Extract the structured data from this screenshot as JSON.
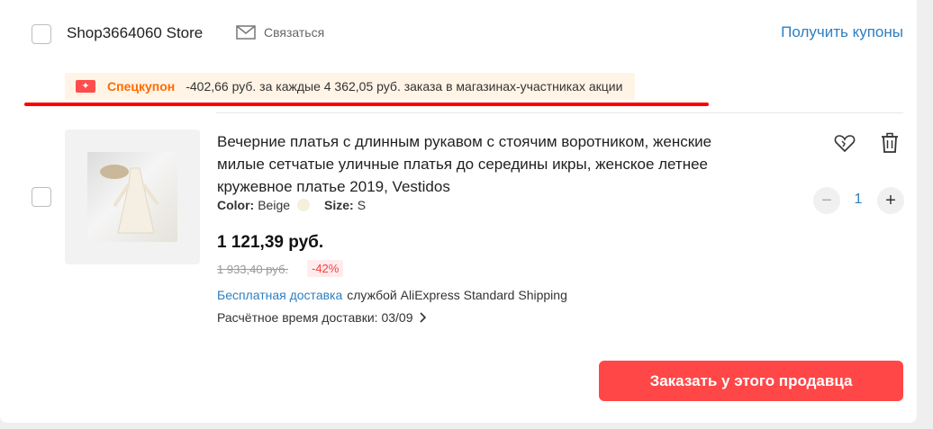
{
  "store": {
    "name": "Shop3664060 Store",
    "contact_label": "Связаться",
    "coupons_link": "Получить купоны"
  },
  "promo": {
    "title": "Спецкупон",
    "text": "-402,66 руб. за каждые 4 362,05 руб. заказа в магазинах-участниках акции",
    "icon": "coupon-icon"
  },
  "product": {
    "title": "Вечерние платья с длинным рукавом с стоячим воротником, женские милые сетчатые уличные платья до середины икры, женское летнее кружевное платье 2019, Vestidos",
    "color_label": "Color:",
    "color_value": "Beige",
    "size_label": "Size:",
    "size_value": "S",
    "price": "1 121,39 руб.",
    "old_price": "1 933,40 руб.",
    "discount": "-42%",
    "shipping_free": "Бесплатная доставка",
    "shipping_service": "службой AliExpress Standard Shipping",
    "delivery_estimate": "Расчётное время доставки: 03/09",
    "quantity": "1"
  },
  "actions": {
    "minus": "−",
    "plus": "+",
    "order_button": "Заказать у этого продавца"
  },
  "colors": {
    "accent_blue": "#2e7fc0",
    "order_red": "#ff4747",
    "promo_orange": "#ff6a00",
    "highlight_red": "#ff0000"
  }
}
